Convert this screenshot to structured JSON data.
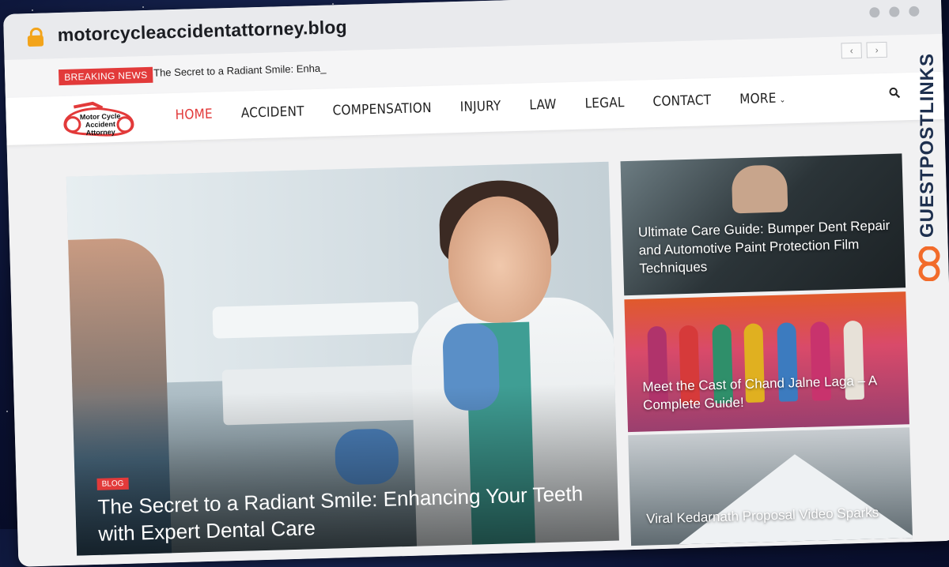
{
  "browser": {
    "url": "motorcycleaccidentattorney.blog"
  },
  "topbar": {
    "breaking_label": "BREAKING NEWS",
    "ticker_text": "The Secret to a Radiant Smile: Enha_",
    "prev_arrow": "‹",
    "next_arrow": "›"
  },
  "logo": {
    "line1": "Motor Cycle",
    "line2": "Accident Attorney"
  },
  "nav": {
    "items": [
      {
        "label": "HOME",
        "active": true
      },
      {
        "label": "ACCIDENT"
      },
      {
        "label": "COMPENSATION"
      },
      {
        "label": "INJURY"
      },
      {
        "label": "LAW"
      },
      {
        "label": "LEGAL"
      },
      {
        "label": "CONTACT"
      },
      {
        "label": "MORE"
      }
    ],
    "more_icon": "chevron-down-icon",
    "search_icon": "search-icon"
  },
  "hero": {
    "category": "BLOG",
    "title": "The Secret to a Radiant Smile: Enhancing Your Teeth with Expert Dental Care"
  },
  "side_posts": [
    {
      "title": "Ultimate Care Guide: Bumper Dent Repair and Automotive Paint Protection Film Techniques"
    },
    {
      "title": "Meet the Cast of Chand Jalne Laga – A Complete Guide!"
    },
    {
      "title": "Viral Kedarnath Proposal Video Sparks"
    }
  ],
  "watermark": {
    "text": "GUESTPOSTLINKS"
  },
  "colors": {
    "accent": "#e23a3a",
    "lock": "#f3a41b",
    "brand_dark": "#1d2f4e",
    "brand_orange": "#f26b2a"
  }
}
